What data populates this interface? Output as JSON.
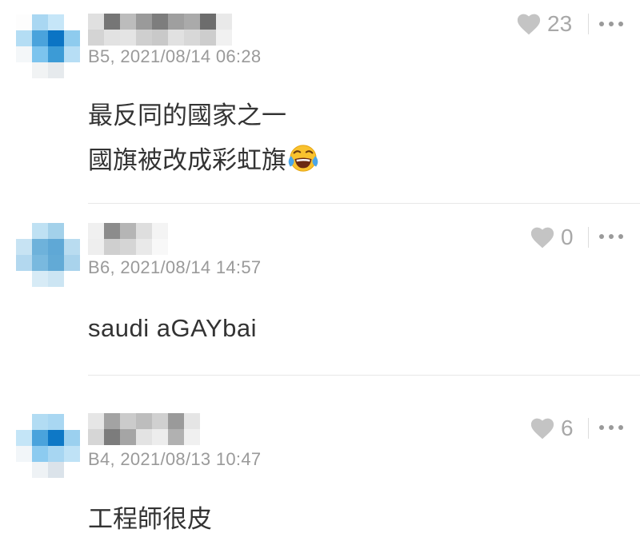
{
  "comments": [
    {
      "floor": "B5",
      "meta": "B5, 2021/08/14 06:28",
      "likes": "23",
      "lines": [
        "最反同的國家之一",
        "國旗被改成彩虹旗"
      ],
      "has_emoji": true,
      "emoji_name": "face-with-tears-of-joy-icon"
    },
    {
      "floor": "B6",
      "meta": "B6, 2021/08/14 14:57",
      "likes": "0",
      "lines": [
        "saudi aGAYbai"
      ],
      "has_emoji": false
    },
    {
      "floor": "B4",
      "meta": "B4, 2021/08/13 10:47",
      "likes": "6",
      "lines": [
        "工程師很皮"
      ],
      "has_emoji": false
    }
  ],
  "colors": {
    "meta_text": "#9a9a9a",
    "like_icon": "#c4c4c4",
    "divider": "#e8e8e8",
    "body_text": "#333333"
  },
  "icons": {
    "like": "heart-icon",
    "more": "more-dots-icon"
  }
}
